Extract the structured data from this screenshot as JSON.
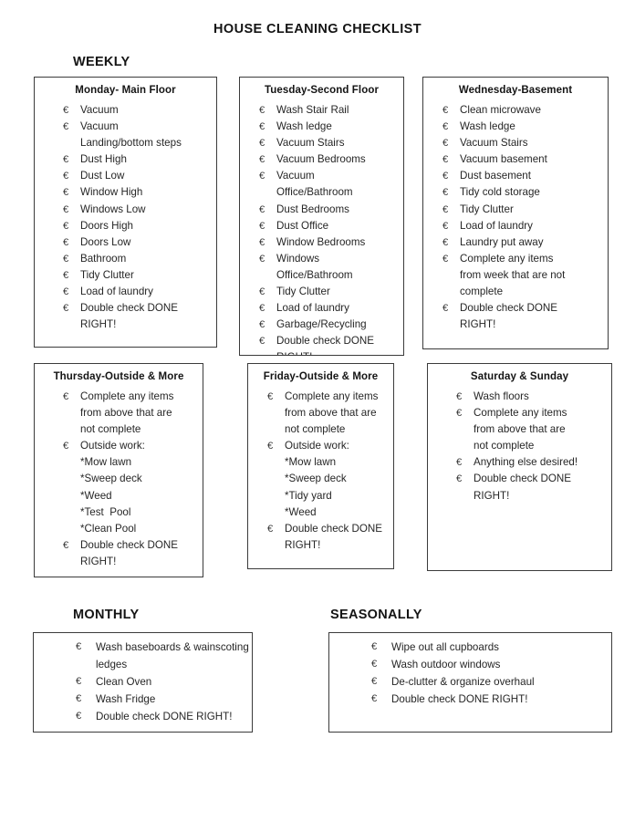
{
  "document": {
    "title": "HOUSE CLEANING CHECKLIST"
  },
  "bullet_glyph": "€",
  "sections": {
    "weekly": {
      "heading": "WEEKLY"
    },
    "monthly": {
      "heading": "MONTHLY"
    },
    "seasonally": {
      "heading": "SEASONALLY"
    }
  },
  "boxes": {
    "monday": {
      "title": "Monday- Main Floor",
      "items": [
        "Vacuum",
        "Vacuum\nLanding/bottom steps",
        "Dust High",
        "Dust Low",
        "Window High",
        "Windows Low",
        "Doors High",
        "Doors Low",
        "Bathroom",
        "Tidy Clutter",
        "Load of laundry",
        "Double check DONE\nRIGHT!"
      ]
    },
    "tuesday": {
      "title": "Tuesday-Second Floor",
      "items": [
        "Wash Stair Rail",
        "Wash ledge",
        "Vacuum Stairs",
        "Vacuum Bedrooms",
        "Vacuum\nOffice/Bathroom",
        "Dust Bedrooms",
        "Dust Office",
        "Window Bedrooms",
        "Windows\nOffice/Bathroom",
        "Tidy Clutter",
        "Load of laundry",
        "Garbage/Recycling",
        "Double check DONE\nRIGHT!"
      ]
    },
    "wednesday": {
      "title": "Wednesday-Basement",
      "items": [
        "Clean microwave",
        "Wash ledge",
        "Vacuum Stairs",
        "Vacuum basement",
        "Dust basement",
        "Tidy cold storage",
        "Tidy Clutter",
        "Load of laundry",
        "Laundry put away",
        "Complete any items\nfrom week that are not\ncomplete",
        "Double check DONE\nRIGHT!"
      ]
    },
    "thursday": {
      "title": "Thursday-Outside & More",
      "items": [
        {
          "bullet": true,
          "text": "Complete any items\nfrom above that are\nnot complete"
        },
        {
          "bullet": true,
          "text": "Outside work:"
        },
        {
          "bullet": false,
          "text": "*Mow lawn"
        },
        {
          "bullet": false,
          "text": "*Sweep deck"
        },
        {
          "bullet": false,
          "text": "*Weed"
        },
        {
          "bullet": false,
          "text": "*Test  Pool"
        },
        {
          "bullet": false,
          "text": "*Clean Pool"
        },
        {
          "bullet": true,
          "text": "Double check DONE\nRIGHT!"
        }
      ]
    },
    "friday": {
      "title": "Friday-Outside & More",
      "items": [
        {
          "bullet": true,
          "text": "Complete any items\nfrom above that are\nnot complete"
        },
        {
          "bullet": true,
          "text": "Outside work:"
        },
        {
          "bullet": false,
          "text": "*Mow lawn"
        },
        {
          "bullet": false,
          "text": "*Sweep deck"
        },
        {
          "bullet": false,
          "text": "*Tidy yard"
        },
        {
          "bullet": false,
          "text": "*Weed"
        },
        {
          "bullet": true,
          "text": "Double check DONE\nRIGHT!"
        }
      ]
    },
    "saturday": {
      "title": "Saturday & Sunday",
      "items": [
        "Wash floors",
        "Complete any items\nfrom above that are\nnot complete",
        "Anything else desired!",
        "Double check DONE\nRIGHT!"
      ]
    },
    "monthly": {
      "items": [
        "Wash baseboards & wainscoting ledges",
        "Clean Oven",
        "Wash Fridge",
        "Double check DONE RIGHT!"
      ]
    },
    "seasonally": {
      "items": [
        "Wipe out all cupboards",
        "Wash outdoor windows",
        "De-clutter & organize overhaul",
        "Double check DONE RIGHT!"
      ]
    }
  },
  "colors": {
    "page_background": "#ffffff",
    "text": "#262626",
    "heading": "#141414",
    "box_border": "#3b3b3b"
  }
}
